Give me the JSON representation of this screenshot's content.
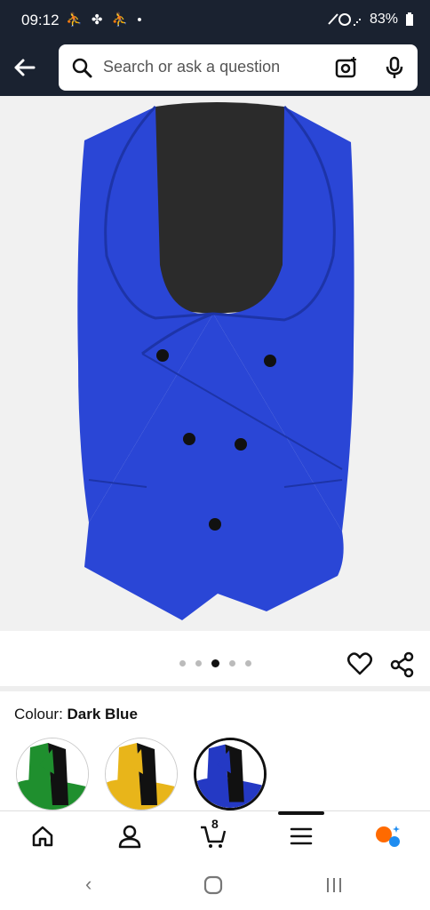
{
  "status": {
    "time": "09:12",
    "icons": "⛹ ✤ ⛹ •",
    "battery": "83%"
  },
  "search": {
    "placeholder": "Search or ask a question"
  },
  "gallery": {
    "dot_count": 5,
    "active_dot": 2
  },
  "product": {
    "colour_label": "Colour: ",
    "colour_value": "Dark Blue",
    "swatches": [
      {
        "name": "Green",
        "color": "#1f8f2e",
        "selected": false
      },
      {
        "name": "Yellow",
        "color": "#e8b51a",
        "selected": false
      },
      {
        "name": "Dark Blue",
        "color": "#2439c4",
        "selected": true
      }
    ]
  },
  "nav": {
    "cart_count": "8"
  },
  "colors": {
    "topbar": "#1a2230",
    "vest": "#2a46d6",
    "lining": "#2b2b2b",
    "accent": "#ff6a00"
  }
}
